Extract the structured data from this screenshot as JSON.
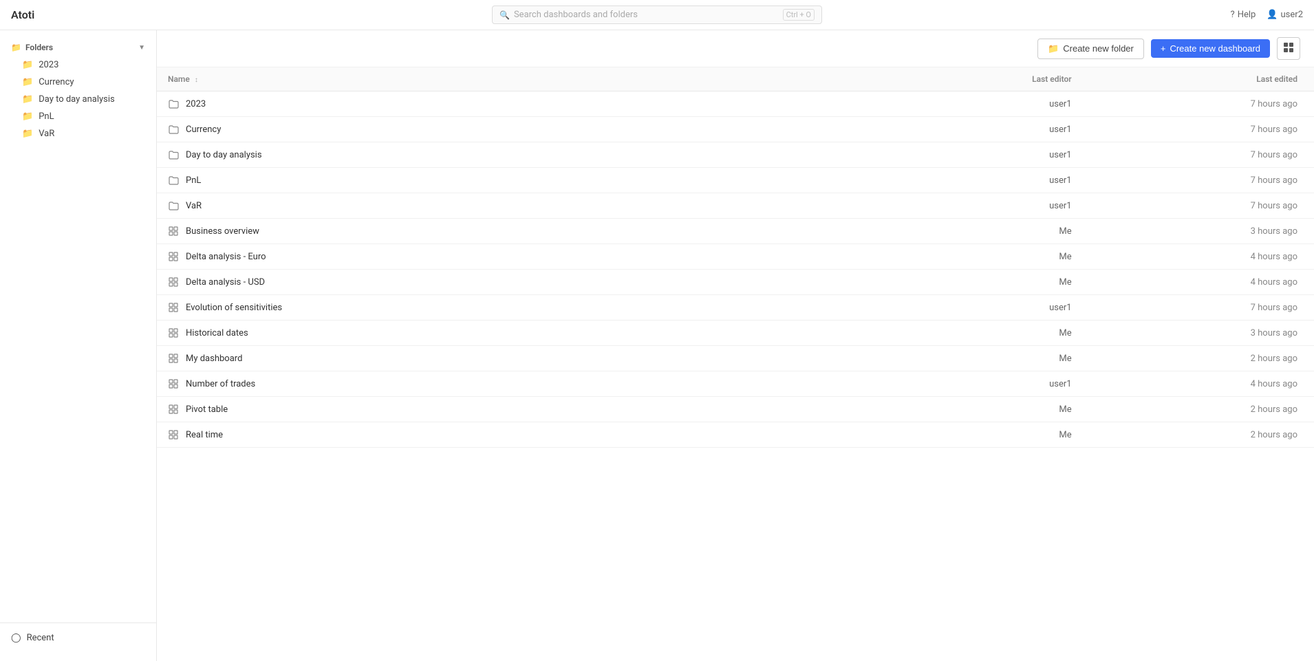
{
  "app": {
    "title": "Atoti"
  },
  "header": {
    "search_placeholder": "Search dashboards and folders",
    "search_shortcut": "Ctrl + O",
    "help_label": "Help",
    "user_label": "user2"
  },
  "toolbar": {
    "new_folder_label": "Create new folder",
    "new_dashboard_label": "Create new dashboard",
    "grid_view_label": "Grid view"
  },
  "sidebar": {
    "folders_label": "Folders",
    "items": [
      {
        "label": "2023",
        "type": "folder"
      },
      {
        "label": "Currency",
        "type": "folder"
      },
      {
        "label": "Day to day analysis",
        "type": "folder"
      },
      {
        "label": "PnL",
        "type": "folder"
      },
      {
        "label": "VaR",
        "type": "folder"
      }
    ],
    "recent_label": "Recent"
  },
  "table": {
    "columns": [
      {
        "key": "name",
        "label": "Name",
        "sortable": true
      },
      {
        "key": "last_editor",
        "label": "Last editor",
        "sortable": false
      },
      {
        "key": "last_edited",
        "label": "Last edited",
        "sortable": false
      }
    ],
    "rows": [
      {
        "name": "2023",
        "type": "folder",
        "last_editor": "user1",
        "last_edited": "7 hours ago"
      },
      {
        "name": "Currency",
        "type": "folder",
        "last_editor": "user1",
        "last_edited": "7 hours ago"
      },
      {
        "name": "Day to day analysis",
        "type": "folder",
        "last_editor": "user1",
        "last_edited": "7 hours ago"
      },
      {
        "name": "PnL",
        "type": "folder",
        "last_editor": "user1",
        "last_edited": "7 hours ago"
      },
      {
        "name": "VaR",
        "type": "folder",
        "last_editor": "user1",
        "last_edited": "7 hours ago"
      },
      {
        "name": "Business overview",
        "type": "dashboard",
        "last_editor": "Me",
        "last_edited": "3 hours ago"
      },
      {
        "name": "Delta analysis - Euro",
        "type": "dashboard",
        "last_editor": "Me",
        "last_edited": "4 hours ago"
      },
      {
        "name": "Delta analysis - USD",
        "type": "dashboard",
        "last_editor": "Me",
        "last_edited": "4 hours ago"
      },
      {
        "name": "Evolution of sensitivities",
        "type": "dashboard",
        "last_editor": "user1",
        "last_edited": "7 hours ago"
      },
      {
        "name": "Historical dates",
        "type": "dashboard",
        "last_editor": "Me",
        "last_edited": "3 hours ago"
      },
      {
        "name": "My dashboard",
        "type": "dashboard",
        "last_editor": "Me",
        "last_edited": "2 hours ago"
      },
      {
        "name": "Number of trades",
        "type": "dashboard",
        "last_editor": "user1",
        "last_edited": "4 hours ago"
      },
      {
        "name": "Pivot table",
        "type": "dashboard",
        "last_editor": "Me",
        "last_edited": "2 hours ago"
      },
      {
        "name": "Real time",
        "type": "dashboard",
        "last_editor": "Me",
        "last_edited": "2 hours ago"
      }
    ]
  }
}
